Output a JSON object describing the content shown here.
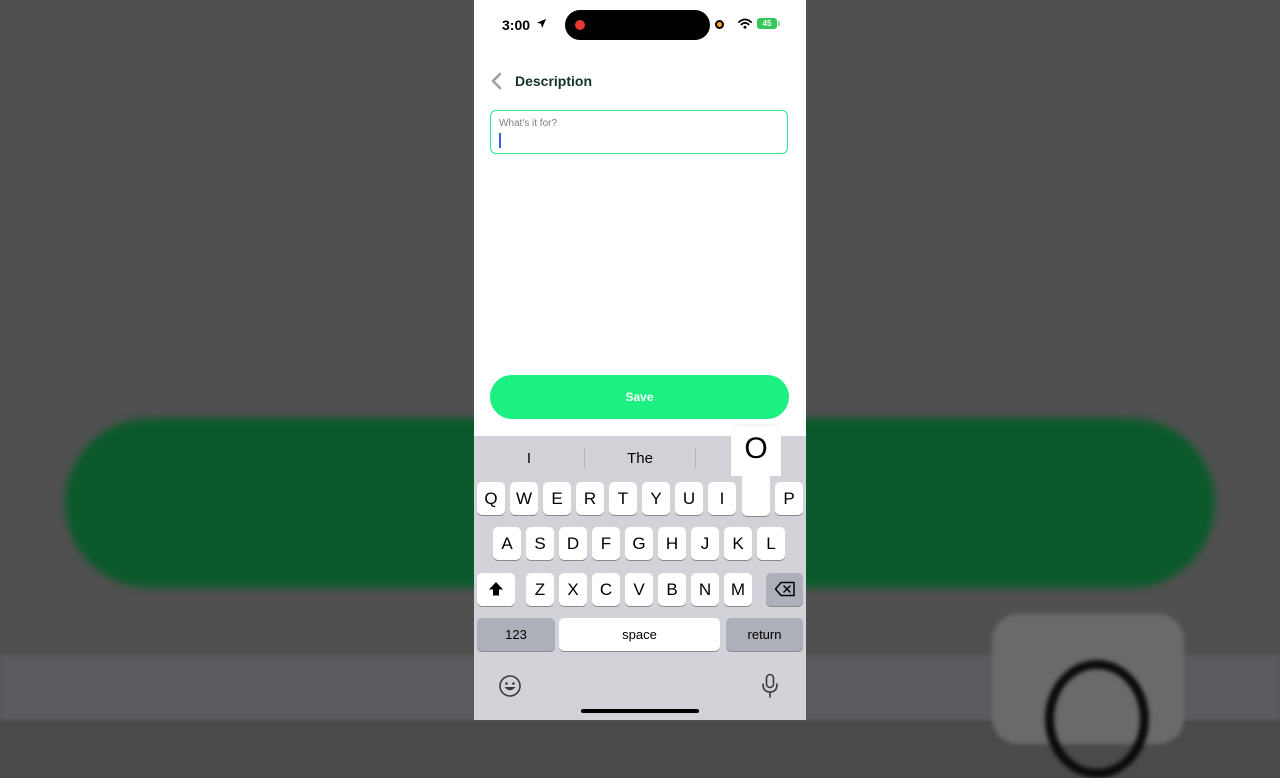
{
  "status_bar": {
    "time": "3:00",
    "battery": "45"
  },
  "header": {
    "title": "Description"
  },
  "description_field": {
    "label": "What's it for?",
    "value": ""
  },
  "save_button": {
    "label": "Save"
  },
  "accent_color": "#1bf080",
  "keyboard": {
    "suggestions": [
      "I",
      "The",
      ""
    ],
    "row1": [
      "Q",
      "W",
      "E",
      "R",
      "T",
      "Y",
      "U",
      "I",
      "O",
      "P"
    ],
    "row2": [
      "A",
      "S",
      "D",
      "F",
      "G",
      "H",
      "J",
      "K",
      "L"
    ],
    "row3": [
      "Z",
      "X",
      "C",
      "V",
      "B",
      "N",
      "M"
    ],
    "numbers_label": "123",
    "space_label": "space",
    "return_label": "return",
    "pressed_key": "O"
  },
  "icons": [
    "location-arrow-icon",
    "wifi-icon",
    "back-chevron-icon",
    "shift-icon",
    "backspace-icon",
    "emoji-icon",
    "microphone-icon"
  ]
}
